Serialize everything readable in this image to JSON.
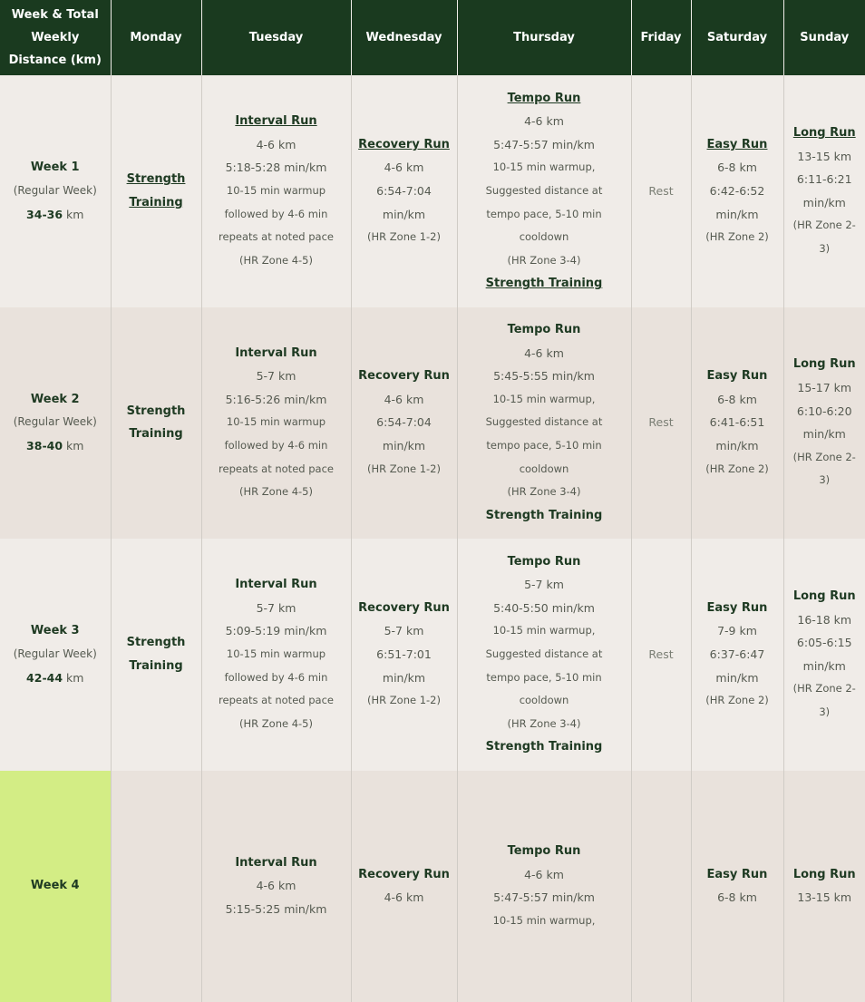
{
  "headers": [
    "Week & Total Weekly Distance (km)",
    "Monday",
    "Tuesday",
    "Wednesday",
    "Thursday",
    "Friday",
    "Saturday",
    "Sunday"
  ],
  "weeks": [
    {
      "name": "Week 1",
      "sub": "(Regular Week)",
      "dist": "34-36",
      "unit": "km",
      "monday": "Strength Training",
      "tuesday": {
        "title": "Interval Run",
        "dist": "4-6 km",
        "pace": "5:18-5:28 min/km",
        "note1": "10-15 min warmup",
        "note2": "followed by 4-6 min",
        "note3": "repeats at noted pace",
        "hr": "(HR Zone 4-5)"
      },
      "wednesday": {
        "title": "Recovery Run",
        "dist": "4-6 km",
        "pace1": "6:54-7:04",
        "pace2": "min/km",
        "hr": "(HR Zone 1-2)"
      },
      "thursday": {
        "title": "Tempo Run",
        "dist": "4-6 km",
        "pace": "5:47-5:57 min/km",
        "note1": "10-15 min warmup,",
        "note2": "Suggested distance at",
        "note3": "tempo pace, 5-10 min",
        "note4": "cooldown",
        "hr": "(HR Zone 3-4)",
        "extra": "Strength Training"
      },
      "friday": "Rest",
      "saturday": {
        "title": "Easy Run",
        "dist": "6-8 km",
        "pace1": "6:42-6:52",
        "pace2": "min/km",
        "hr": "(HR Zone 2)"
      },
      "sunday": {
        "title": "Long Run",
        "dist": "13-15 km",
        "pace1": "6:11-6:21",
        "pace2": "min/km",
        "hr1": "(HR Zone 2-",
        "hr2": "3)"
      }
    },
    {
      "name": "Week 2",
      "sub": "(Regular Week)",
      "dist": "38-40",
      "unit": "km",
      "monday": "Strength Training",
      "tuesday": {
        "title": "Interval Run",
        "dist": "5-7 km",
        "pace": "5:16-5:26 min/km",
        "note1": "10-15 min warmup",
        "note2": "followed by 4-6 min",
        "note3": "repeats at noted pace",
        "hr": "(HR Zone 4-5)"
      },
      "wednesday": {
        "title": "Recovery Run",
        "dist": "4-6 km",
        "pace1": "6:54-7:04",
        "pace2": "min/km",
        "hr": "(HR Zone 1-2)"
      },
      "thursday": {
        "title": "Tempo Run",
        "dist": "4-6 km",
        "pace": "5:45-5:55 min/km",
        "note1": "10-15 min warmup,",
        "note2": "Suggested distance at",
        "note3": "tempo pace, 5-10 min",
        "note4": "cooldown",
        "hr": "(HR Zone 3-4)",
        "extra": "Strength Training"
      },
      "friday": "Rest",
      "saturday": {
        "title": "Easy Run",
        "dist": "6-8 km",
        "pace1": "6:41-6:51",
        "pace2": "min/km",
        "hr": "(HR Zone 2)"
      },
      "sunday": {
        "title": "Long Run",
        "dist": "15-17 km",
        "pace1": "6:10-6:20",
        "pace2": "min/km",
        "hr1": "(HR Zone 2-",
        "hr2": "3)"
      }
    },
    {
      "name": "Week 3",
      "sub": "(Regular Week)",
      "dist": "42-44",
      "unit": "km",
      "monday": "Strength Training",
      "tuesday": {
        "title": "Interval Run",
        "dist": "5-7 km",
        "pace": "5:09-5:19 min/km",
        "note1": "10-15 min warmup",
        "note2": "followed by 4-6 min",
        "note3": "repeats at noted pace",
        "hr": "(HR Zone 4-5)"
      },
      "wednesday": {
        "title": "Recovery Run",
        "dist": "5-7 km",
        "pace1": "6:51-7:01",
        "pace2": "min/km",
        "hr": "(HR Zone 1-2)"
      },
      "thursday": {
        "title": "Tempo Run",
        "dist": "5-7 km",
        "pace": "5:40-5:50 min/km",
        "note1": "10-15 min warmup,",
        "note2": "Suggested distance at",
        "note3": "tempo pace, 5-10 min",
        "note4": "cooldown",
        "hr": "(HR Zone 3-4)",
        "extra": "Strength Training"
      },
      "friday": "Rest",
      "saturday": {
        "title": "Easy Run",
        "dist": "7-9 km",
        "pace1": "6:37-6:47",
        "pace2": "min/km",
        "hr": "(HR Zone 2)"
      },
      "sunday": {
        "title": "Long Run",
        "dist": "16-18 km",
        "pace1": "6:05-6:15",
        "pace2": "min/km",
        "hr1": "(HR Zone 2-",
        "hr2": "3)"
      }
    },
    {
      "name": "Week 4",
      "tuesday": {
        "title": "Interval Run",
        "dist": "4-6 km",
        "pace": "5:15-5:25 min/km"
      },
      "wednesday": {
        "title": "Recovery Run",
        "dist": "4-6 km"
      },
      "thursday": {
        "title": "Tempo Run",
        "dist": "4-6 km",
        "pace": "5:47-5:57 min/km",
        "note1": "10-15 min warmup,"
      },
      "saturday": {
        "title": "Easy Run",
        "dist": "6-8 km"
      },
      "sunday": {
        "title": "Long Run",
        "dist": "13-15 km"
      }
    }
  ]
}
